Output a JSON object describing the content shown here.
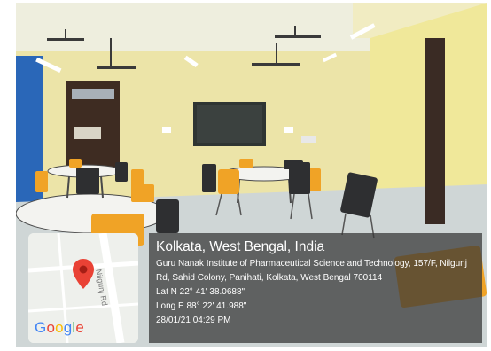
{
  "location": {
    "title": "Kolkata, West Bengal, India",
    "address": "Guru Nanak Institute of Pharmaceutical Science and Technology, 157/F, Nilgunj Rd, Sahid Colony, Panihati, Kolkata, West Bengal 700114",
    "latitude": "Lat N 22° 41' 38.0688\"",
    "longitude": "Long E 88° 22' 41.988\"",
    "datetime": "28/01/21 04:29 PM"
  },
  "map": {
    "road_label": "Nilgunj Rd",
    "logo_letters": [
      {
        "char": "G",
        "color": "#4285F4"
      },
      {
        "char": "o",
        "color": "#EA4335"
      },
      {
        "char": "o",
        "color": "#FBBC05"
      },
      {
        "char": "g",
        "color": "#4285F4"
      },
      {
        "char": "l",
        "color": "#34A853"
      },
      {
        "char": "e",
        "color": "#EA4335"
      }
    ],
    "pin_color": "#E94235"
  }
}
